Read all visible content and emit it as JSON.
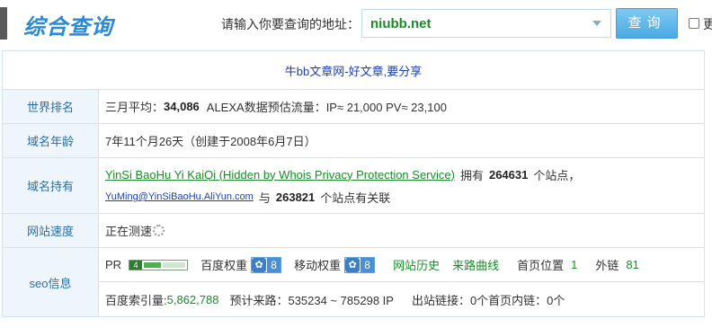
{
  "header": {
    "title": "综合查询",
    "query_label": "请输入你要查询的地址：",
    "query_value": "niubb.net",
    "query_button": "查询",
    "checkbox_label": "更"
  },
  "slogan": "牛bb文章网-好文章,要分享",
  "rows": {
    "rank": {
      "label": "世界排名",
      "prefix": "三月平均：",
      "value": "34,086",
      "alexa_text": "ALEXA数据预估流量：IP≈ 21,000 PV≈ 23,100"
    },
    "age": {
      "label": "域名年龄",
      "value": "7年11个月26天（创建于2008年6月7日）"
    },
    "owner": {
      "label": "域名持有",
      "owner_name": "YinSi BaoHu Yi KaiQi (Hidden by Whois Privacy Protection Service)",
      "owns_prefix": "拥有",
      "owns_count": "264631",
      "owns_suffix": "个站点，",
      "email": "YuMing@YinSiBaoHu.AliYun.com",
      "related_prefix": "与",
      "related_count": "263821",
      "related_suffix": "个站点有关联"
    },
    "speed": {
      "label": "网站速度",
      "value": "正在测速"
    },
    "seo": {
      "label": "seo信息",
      "pr_label": "PR",
      "pr_value": "4",
      "pr_fraction": 0.4,
      "baidu_weight_label": "百度权重",
      "baidu_weight_value": "8",
      "mobile_weight_label": "移动权重",
      "mobile_weight_value": "8",
      "site_history": "网站历史",
      "traffic_curve": "来路曲线",
      "home_position_label": "首页位置",
      "home_position_value": "1",
      "outlinks_label": "外链",
      "outlinks_value": "81",
      "baidu_index_label": "百度索引量:",
      "baidu_index_value": "5,862,788",
      "estimated_traffic": "预计来路：535234 ~ 785298 IP",
      "outbound_links": "出站链接：0个首页内链：0个"
    }
  },
  "icons": {
    "dropdown": "chevron-down-icon",
    "spinner": "loading-spinner-icon",
    "paw": "baidu-paw-icon"
  },
  "colors": {
    "accent_blue": "#2a8ad6",
    "link_green": "#1a8a2a",
    "link_blue": "#1b3fae",
    "label_bg": "#eef5fb",
    "border": "#cfe3f1"
  }
}
